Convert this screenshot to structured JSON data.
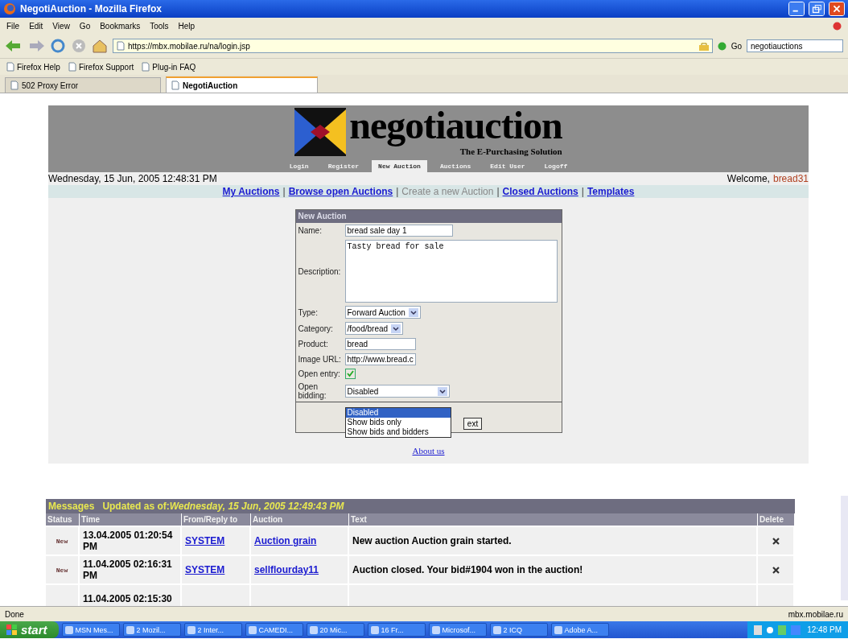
{
  "window": {
    "title": "NegotiAuction - Mozilla Firefox"
  },
  "menu": [
    "File",
    "Edit",
    "View",
    "Go",
    "Bookmarks",
    "Tools",
    "Help"
  ],
  "address": {
    "url": "https://mbx.mobilae.ru/na/login.jsp"
  },
  "go_label": "Go",
  "search": {
    "value": "negotiauctions"
  },
  "bookmarks": [
    "Firefox Help",
    "Firefox Support",
    "Plug-in FAQ"
  ],
  "tabs": [
    {
      "label": "502 Proxy Error",
      "selected": false
    },
    {
      "label": "NegotiAuction",
      "selected": true
    }
  ],
  "site": {
    "logo": "negotiauction",
    "tagline": "The E-Purchasing Solution",
    "nav": [
      {
        "label": "Login",
        "selected": false
      },
      {
        "label": "Register",
        "selected": false
      },
      {
        "label": "New Auction",
        "selected": true
      },
      {
        "label": "Auctions",
        "selected": false
      },
      {
        "label": "Edit User",
        "selected": false
      },
      {
        "label": "Logoff",
        "selected": false
      }
    ],
    "date": "Wednesday, 15 Jun, 2005 12:48:31 PM",
    "welcome": "Welcome,",
    "user": "bread31",
    "links": [
      {
        "label": "My Auctions",
        "selected": false
      },
      {
        "label": "Browse open Auctions",
        "selected": false
      },
      {
        "label": "Create a new Auction",
        "selected": true
      },
      {
        "label": "Closed Auctions",
        "selected": false
      },
      {
        "label": "Templates",
        "selected": false
      }
    ],
    "separator": "|"
  },
  "form": {
    "title": "New Auction",
    "fields": [
      {
        "kind": "text",
        "label": "Name:",
        "value": "bread sale day 1"
      },
      {
        "kind": "textarea",
        "label": "Description:",
        "value": "Tasty bread for sale"
      },
      {
        "kind": "select",
        "label": "Type:",
        "value": "Forward Auction"
      },
      {
        "kind": "select",
        "label": "Category:",
        "value": "/food/bread"
      },
      {
        "kind": "text",
        "label": "Product:",
        "value": "bread"
      },
      {
        "kind": "text",
        "label": "Image URL:",
        "value": "http://www.bread.c"
      },
      {
        "kind": "checkbox",
        "label": "Open entry:",
        "checked": true
      },
      {
        "kind": "select",
        "label": "Open bidding:",
        "value": "Disabled"
      }
    ],
    "options": [
      {
        "label": "Disabled",
        "selected": true
      },
      {
        "label": "Show bids only",
        "selected": false
      },
      {
        "label": "Show bids and bidders",
        "selected": false
      }
    ],
    "button": "ext"
  },
  "about_link": "About us",
  "messages": {
    "title": "Messages",
    "updated_label": "Updated as of:",
    "updated": "Wednesday, 15 Jun, 2005 12:49:43 PM",
    "columns": [
      "Status",
      "Time",
      "From/Reply to",
      "Auction",
      "Text",
      "Delete"
    ],
    "rows": [
      {
        "status": "New",
        "time": "13.04.2005 01:20:54 PM",
        "from": "SYSTEM",
        "auction": "Auction grain",
        "text": "New auction Auction grain started."
      },
      {
        "status": "New",
        "time": "11.04.2005 02:16:31 PM",
        "from": "SYSTEM",
        "auction": "sellflourday11",
        "text": "Auction closed. Your bid#1904 won in the auction!"
      },
      {
        "time": "11.04.2005 02:15:30"
      }
    ]
  },
  "status_bar": {
    "text": "Done",
    "host": "mbx.mobilae.ru"
  },
  "taskbar": {
    "start": "start",
    "items": [
      "MSN Mes...",
      "2 Mozil...",
      "2 Inter...",
      "CAMEDI...",
      "20 Mic...",
      "16 Fr...",
      "Microsof...",
      "2 ICQ",
      "Adobe A..."
    ],
    "clock": "12:48 PM"
  }
}
